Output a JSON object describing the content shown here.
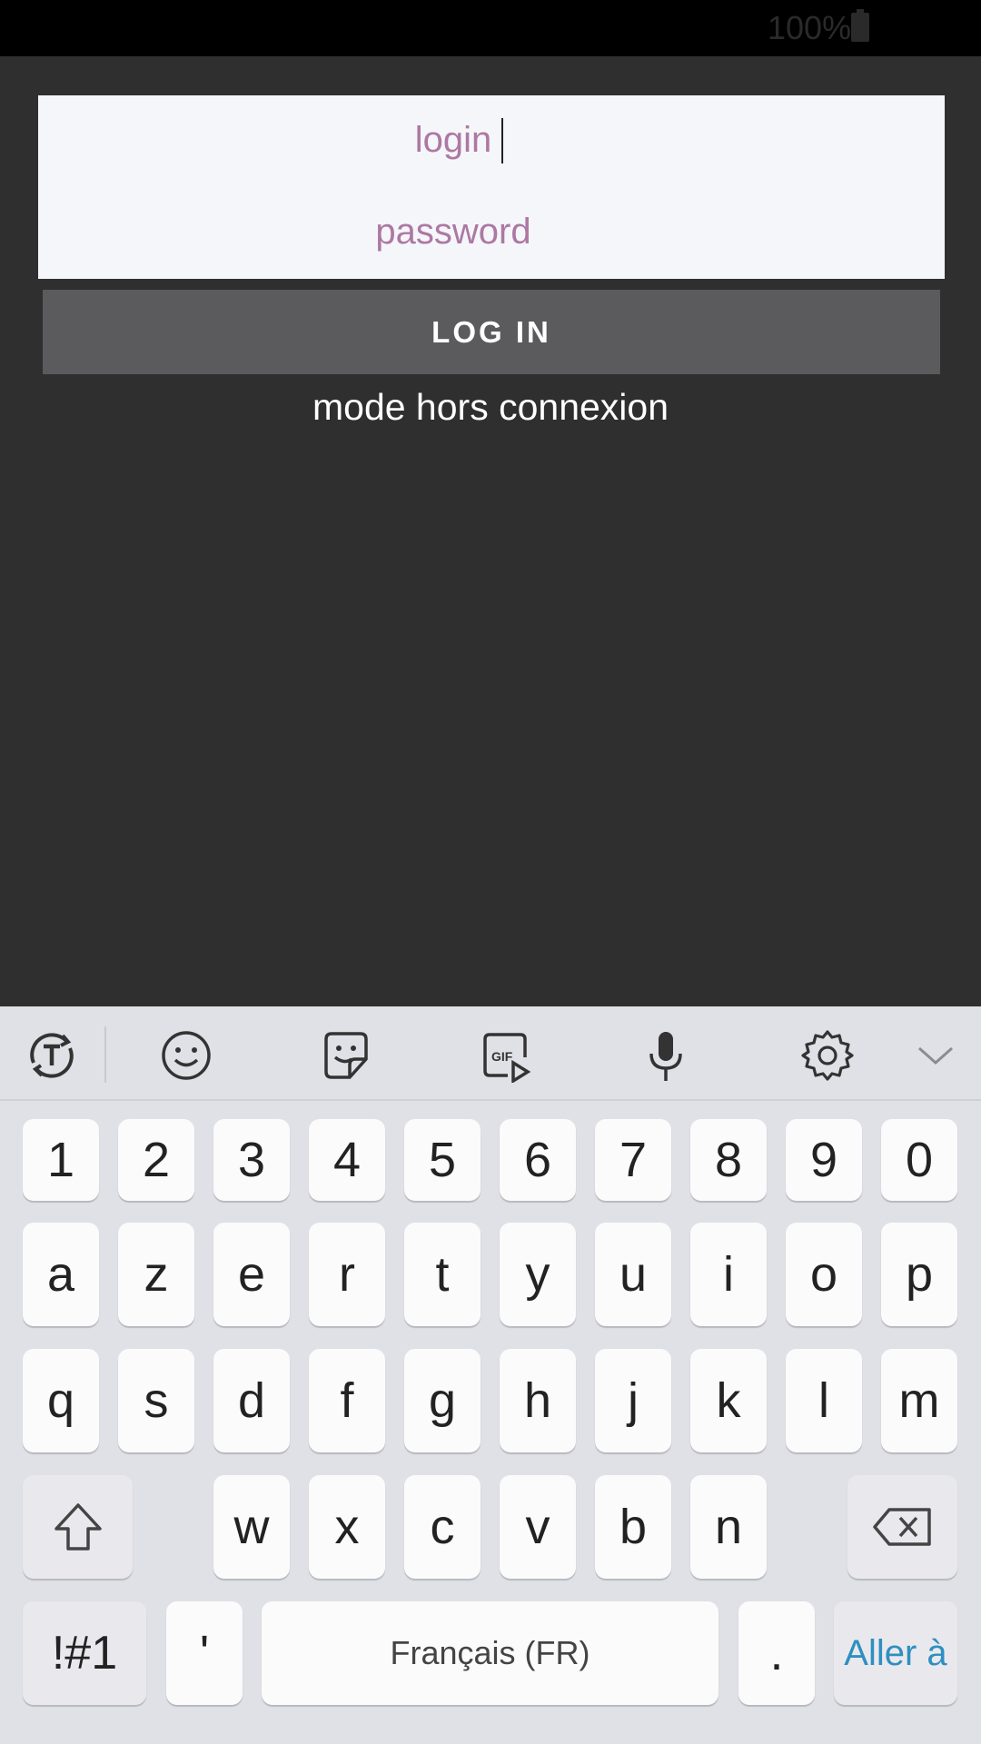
{
  "status_bar": {
    "battery_text": "100%",
    "battery_icon": "battery-full-icon"
  },
  "login_form": {
    "login_placeholder": "login",
    "password_placeholder": "password",
    "login_button_label": "LOG IN",
    "offline_mode_label": "mode hors connexion"
  },
  "colors": {
    "background": "#2f2f2f",
    "panel": "#f5f6fa",
    "placeholder": "#ad78a3",
    "button": "#5b5a5d",
    "keyboard": "#e0e1e6",
    "action_key_text": "#2f8fc0"
  },
  "keyboard": {
    "toolbar_icons": [
      "translate-icon",
      "emoji-icon",
      "sticker-icon",
      "gif-icon",
      "microphone-icon",
      "settings-icon",
      "chevron-down-icon"
    ],
    "row_numbers": [
      "1",
      "2",
      "3",
      "4",
      "5",
      "6",
      "7",
      "8",
      "9",
      "0"
    ],
    "row_1": [
      "a",
      "z",
      "e",
      "r",
      "t",
      "y",
      "u",
      "i",
      "o",
      "p"
    ],
    "row_2": [
      "q",
      "s",
      "d",
      "f",
      "g",
      "h",
      "j",
      "k",
      "l",
      "m"
    ],
    "row_3": [
      "w",
      "x",
      "c",
      "v",
      "b",
      "n"
    ],
    "symbols_key": "!#1",
    "apostrophe_key": "'",
    "space_key": "Français (FR)",
    "period_key": ".",
    "action_key": "Aller à",
    "shift_icon": "shift-icon",
    "backspace_icon": "backspace-icon"
  }
}
